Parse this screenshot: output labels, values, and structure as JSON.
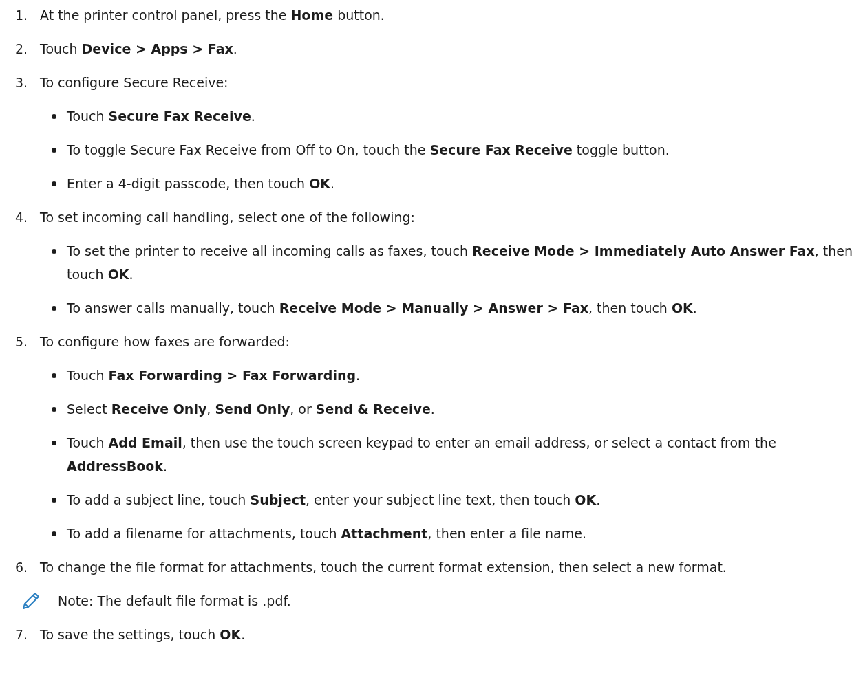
{
  "steps": [
    {
      "number": "1.",
      "text": "At the printer control panel, press the **Home** button."
    },
    {
      "number": "2.",
      "text": "Touch **Device > Apps > Fax**."
    },
    {
      "number": "3.",
      "text": "To configure Secure Receive:",
      "bullets": [
        "Touch **Secure Fax Receive**.",
        "To toggle Secure Fax Receive from Off to On, touch the **Secure Fax Receive** toggle button.",
        "Enter a 4-digit passcode, then touch **OK**."
      ]
    },
    {
      "number": "4.",
      "text": "To set incoming call handling, select one of the following:",
      "bullets": [
        "To set the printer to receive all incoming calls as faxes, touch **Receive Mode > Immediately Auto Answer Fax**, then touch **OK**.",
        "To answer calls manually, touch **Receive Mode > Manually > Answer > Fax**, then touch **OK**."
      ]
    },
    {
      "number": "5.",
      "text": "To configure how faxes are forwarded:",
      "bullets": [
        "Touch **Fax Forwarding > Fax Forwarding**.",
        "Select **Receive Only**, **Send Only**, or **Send & Receive**.",
        "Touch **Add Email**, then use the touch screen keypad to enter an email address, or select a contact from the **AddressBook**.",
        "To add a subject line, touch **Subject**, enter your subject line text, then touch **OK**.",
        "To add a filename for attachments, touch **Attachment**, then enter a file name."
      ]
    },
    {
      "number": "6.",
      "text": "To change the file format for attachments, touch the current format extension, then select a new format.",
      "note": "Note: The default file format is .pdf."
    },
    {
      "number": "7.",
      "text": "To save the settings, touch **OK**."
    }
  ]
}
